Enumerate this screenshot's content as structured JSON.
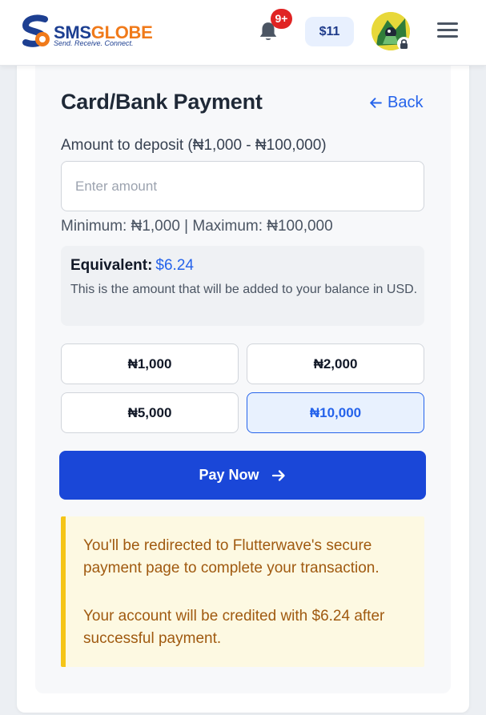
{
  "header": {
    "brand_sms": "SMS",
    "brand_globe": "GLOBE",
    "tagline": "Send. Receive. Connect.",
    "notification_badge": "9+",
    "balance": "$11",
    "icons": [
      "logo-mark",
      "bell-icon",
      "avatar",
      "lock-icon",
      "menu-icon"
    ]
  },
  "payment": {
    "title": "Card/Bank Payment",
    "back_label": "Back",
    "amount_label": "Amount to deposit (₦1,000 - ₦100,000)",
    "amount_placeholder": "Enter amount",
    "amount_value": "",
    "min_max_text": "Minimum: ₦1,000 | Maximum: ₦100,000",
    "equivalent_label": "Equivalent:",
    "equivalent_value": "$6.24",
    "equivalent_note": "This is the amount that will be added to your balance in USD.",
    "quick_amounts": [
      {
        "label": "₦1,000",
        "selected": false
      },
      {
        "label": "₦2,000",
        "selected": false
      },
      {
        "label": "₦5,000",
        "selected": false
      },
      {
        "label": "₦10,000",
        "selected": true
      }
    ],
    "pay_button": "Pay Now",
    "notice_line1": "You'll be redirected to Flutterwave's secure payment page to complete your transaction.",
    "notice_line2": "Your account will be credited with $6.24 after successful payment."
  },
  "colors": {
    "primary": "#1a47d8",
    "link": "#2563eb",
    "brand_blue": "#1d3f91",
    "brand_orange": "#f07a1a",
    "badge": "#e02424",
    "notice_bg": "#fdf9e2",
    "notice_border": "#f5c518",
    "notice_text": "#a05a10"
  }
}
